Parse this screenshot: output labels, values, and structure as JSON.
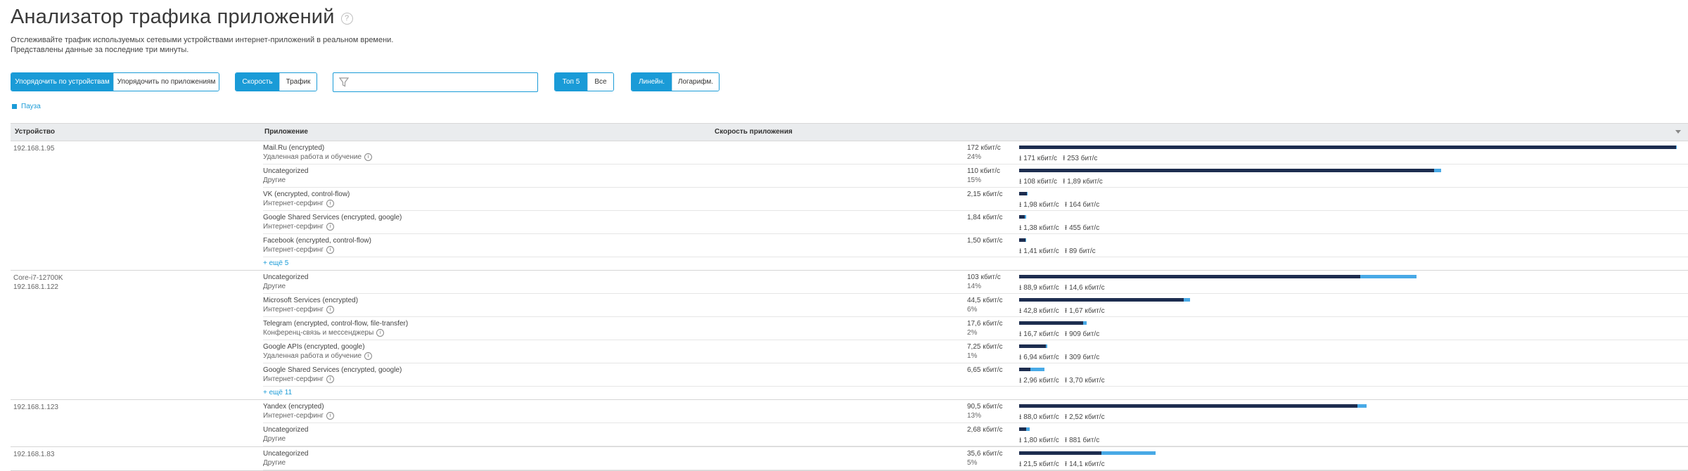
{
  "page": {
    "title": "Анализатор трафика приложений",
    "help_icon": "?",
    "description": "Отслеживайте трафик используемых сетевыми устройствами интернет-приложений в реальном времени. Представлены данные за последние три минуты."
  },
  "controls": {
    "sort_by_device": "Упорядочить по устройствам",
    "sort_by_app": "Упорядочить по приложениям",
    "speed": "Скорость",
    "traffic": "Трафик",
    "filter_placeholder": "",
    "filter_icon": "funnel-icon",
    "top5": "Топ 5",
    "all": "Все",
    "linear": "Линейн.",
    "log": "Логарифм.",
    "accent_color": "#1a9bd7",
    "pause": "Пауза"
  },
  "table": {
    "headers": {
      "device": "Устройство",
      "app": "Приложение",
      "speed": "Скорость приложения"
    },
    "download_color": "#1d2d4f",
    "upload_color": "#48a9e6",
    "groups": [
      {
        "device": [
          "192.168.1.95"
        ],
        "more": "+ ещё 5",
        "apps": [
          {
            "name": "Mail.Ru (encrypted)",
            "category": "Удаленная работа и обучение",
            "speed": "172 кбит/с",
            "pct": "24%",
            "down": "171 кбит/с",
            "up": "253 бит/с",
            "down_val": 171,
            "up_val": 0.25
          },
          {
            "name": "Uncategorized",
            "category": "Другие",
            "speed": "110 кбит/с",
            "pct": "15%",
            "down": "108 кбит/с",
            "up": "1,89 кбит/с",
            "down_val": 108,
            "up_val": 1.89
          },
          {
            "name": "VK (encrypted, control-flow)",
            "category": "Интернет-серфинг",
            "speed": "2,15 кбит/с",
            "pct": "",
            "down": "1,98 кбит/с",
            "up": "164 бит/с",
            "down_val": 1.98,
            "up_val": 0.16
          },
          {
            "name": "Google Shared Services (encrypted, google)",
            "category": "Интернет-серфинг",
            "speed": "1,84 кбит/с",
            "pct": "",
            "down": "1,38 кбит/с",
            "up": "455 бит/с",
            "down_val": 1.38,
            "up_val": 0.46
          },
          {
            "name": "Facebook (encrypted, control-flow)",
            "category": "Интернет-серфинг",
            "speed": "1,50 кбит/с",
            "pct": "",
            "down": "1,41 кбит/с",
            "up": "89 бит/с",
            "down_val": 1.41,
            "up_val": 0.09
          }
        ]
      },
      {
        "device": [
          "Core-i7-12700K",
          "192.168.1.122"
        ],
        "more": "+ ещё 11",
        "apps": [
          {
            "name": "Uncategorized",
            "category": "Другие",
            "speed": "103 кбит/с",
            "pct": "14%",
            "down": "88,9 кбит/с",
            "up": "14,6 кбит/с",
            "down_val": 88.9,
            "up_val": 14.6
          },
          {
            "name": "Microsoft Services (encrypted)",
            "category": "Интернет-серфинг",
            "speed": "44,5 кбит/с",
            "pct": "6%",
            "down": "42,8 кбит/с",
            "up": "1,67 кбит/с",
            "down_val": 42.8,
            "up_val": 1.67
          },
          {
            "name": "Telegram (encrypted, control-flow, file-transfer)",
            "category": "Конференц-связь и мессенджеры",
            "speed": "17,6 кбит/с",
            "pct": "2%",
            "down": "16,7 кбит/с",
            "up": "909 бит/с",
            "down_val": 16.7,
            "up_val": 0.91
          },
          {
            "name": "Google APIs (encrypted, google)",
            "category": "Удаленная работа и обучение",
            "speed": "7,25 кбит/с",
            "pct": "1%",
            "down": "6,94 кбит/с",
            "up": "309 бит/с",
            "down_val": 6.94,
            "up_val": 0.31
          },
          {
            "name": "Google Shared Services (encrypted, google)",
            "category": "Интернет-серфинг",
            "speed": "6,65 кбит/с",
            "pct": "",
            "down": "2,96 кбит/с",
            "up": "3,70 кбит/с",
            "down_val": 2.96,
            "up_val": 3.7
          }
        ]
      },
      {
        "device": [
          "192.168.1.123"
        ],
        "more": "",
        "apps": [
          {
            "name": "Yandex (encrypted)",
            "category": "Интернет-серфинг",
            "speed": "90,5 кбит/с",
            "pct": "13%",
            "down": "88,0 кбит/с",
            "up": "2,52 кбит/с",
            "down_val": 88.0,
            "up_val": 2.52
          },
          {
            "name": "Uncategorized",
            "category": "Другие",
            "speed": "2,68 кбит/с",
            "pct": "",
            "down": "1,80 кбит/с",
            "up": "881 бит/с",
            "down_val": 1.8,
            "up_val": 0.88
          }
        ]
      },
      {
        "device": [
          "192.168.1.83"
        ],
        "more": "",
        "apps": [
          {
            "name": "Uncategorized",
            "category": "Другие",
            "speed": "35,6 кбит/с",
            "pct": "5%",
            "down": "21,5 кбит/с",
            "up": "14,1 кбит/с",
            "down_val": 21.5,
            "up_val": 14.1
          }
        ]
      }
    ]
  }
}
